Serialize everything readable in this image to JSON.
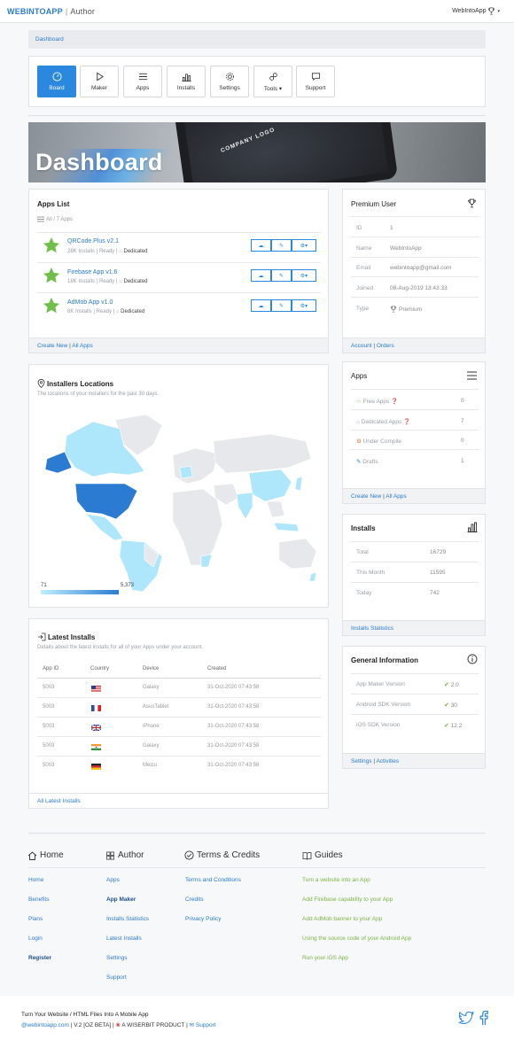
{
  "topbar": {
    "brand": "WEBINTOAPP",
    "brand_sep": "|",
    "brand_sub": "Author",
    "user": "WebIntoApp",
    "user_icon": "trophy-icon"
  },
  "breadcrumb": "Dashboard",
  "nav": [
    {
      "label": "Board",
      "icon": "gauge-icon",
      "active": true
    },
    {
      "label": "Maker",
      "icon": "play-icon"
    },
    {
      "label": "Apps",
      "icon": "list-icon"
    },
    {
      "label": "Installs",
      "icon": "bar-chart-icon"
    },
    {
      "label": "Settings",
      "icon": "gear-icon"
    },
    {
      "label": "Tools ▾",
      "icon": "link-icon"
    },
    {
      "label": "Support",
      "icon": "chat-icon"
    }
  ],
  "hero": {
    "title": "Dashboard",
    "logo_text": "COMPANY LOGO"
  },
  "apps_list": {
    "title": "Apps List",
    "filter": "All / 7 Apps",
    "apps": [
      {
        "name": "QRCode.Plus v2.1",
        "installs": "28K Installs",
        "status": "Ready",
        "type": "Dedicated"
      },
      {
        "name": "Firebase App v1.6",
        "installs": "18K Installs",
        "status": "Ready",
        "type": "Dedicated"
      },
      {
        "name": "AdMob App v1.0",
        "installs": "8K Installs",
        "status": "Ready",
        "type": "Dedicated"
      }
    ],
    "footer_create": "Create New",
    "footer_sep": "|",
    "footer_all": "All Apps"
  },
  "locations": {
    "title": "Installers Locations",
    "subtitle": "The locations of your installers for the past 30 days.",
    "legend_min": "71",
    "legend_max": "5,373",
    "color_low": "#bfefff",
    "color_high": "#2a7bd1"
  },
  "latest": {
    "title": "Latest Installs",
    "subtitle": "Details about the latest installs for all of your Apps under your account.",
    "headers": [
      "App ID",
      "Country",
      "Device",
      "Created"
    ],
    "rows": [
      {
        "id": "5003",
        "flag": "us",
        "device": "Galaxy",
        "created": "31-Oct-2020 07:43:58"
      },
      {
        "id": "5003",
        "flag": "fr",
        "device": "AsusTablet",
        "created": "31-Oct-2020 07:43:58"
      },
      {
        "id": "5003",
        "flag": "gb",
        "device": "iPhone",
        "created": "31-Oct-2020 07:43:58"
      },
      {
        "id": "5003",
        "flag": "in",
        "device": "Galaxy",
        "created": "31-Oct-2020 07:43:58"
      },
      {
        "id": "5003",
        "flag": "de",
        "device": "Meizu",
        "created": "31-Oct-2020 07:43:58"
      }
    ],
    "footer": "All Latest Installs"
  },
  "premium": {
    "title": "Premium User",
    "rows": [
      {
        "k": "ID",
        "v": "1"
      },
      {
        "k": "Name",
        "v": "WebIntoApp"
      },
      {
        "k": "Email",
        "v": "webintoapp@gmail.com"
      },
      {
        "k": "Joined",
        "v": "08-Aug-2019 13:43:33"
      },
      {
        "k": "Type",
        "v": "Premium"
      }
    ],
    "footer_account": "Account",
    "footer_sep": "|",
    "footer_orders": "Orders"
  },
  "apps_card": {
    "title": "Apps",
    "rows": [
      {
        "k": "Free Apps",
        "v": "0"
      },
      {
        "k": "Dedicated Apps",
        "v": "7"
      },
      {
        "k": "Under Compile",
        "v": "0"
      },
      {
        "k": "Drafts",
        "v": "1"
      }
    ],
    "footer_create": "Create New",
    "footer_sep": "|",
    "footer_all": "All Apps"
  },
  "installs_card": {
    "title": "Installs",
    "rows": [
      {
        "k": "Total",
        "v": "16729"
      },
      {
        "k": "This Month",
        "v": "11595"
      },
      {
        "k": "Today",
        "v": "742"
      }
    ],
    "footer": "Installs Statistics"
  },
  "general": {
    "title": "General Information",
    "rows": [
      {
        "k": "App Maker Version",
        "v": "2.0"
      },
      {
        "k": "Android SDK Version",
        "v": "30"
      },
      {
        "k": "iOS SDK Version",
        "v": "12.2"
      }
    ],
    "footer_settings": "Settings",
    "footer_sep": "|",
    "footer_activities": "Activities"
  },
  "footer": {
    "cols": [
      {
        "title": "Home",
        "links": [
          "Home",
          "Benefits",
          "Plans",
          "Login",
          "Register"
        ]
      },
      {
        "title": "Author",
        "links": [
          "Apps",
          "App Maker",
          "Installs Statistics",
          "Latest Installs",
          "Settings",
          "Support"
        ]
      },
      {
        "title": "Terms & Credits",
        "links": [
          "Terms and Conditions",
          "Credits",
          "Privacy Policy"
        ]
      },
      {
        "title": "Guides",
        "links": [
          "Turn a website into an App",
          "Add Firebase capability to your App",
          "Add AdMob banner to your App",
          "Using the source code of your Android App",
          "Run your iOS App"
        ]
      }
    ],
    "tagline": "Turn Your Website / HTML Files Into A Mobile App",
    "site": "@webintoapp.com",
    "version": "| V.2 [OZ BETA] |",
    "product": "A WISERBIT PRODUCT |",
    "support": "Support"
  }
}
